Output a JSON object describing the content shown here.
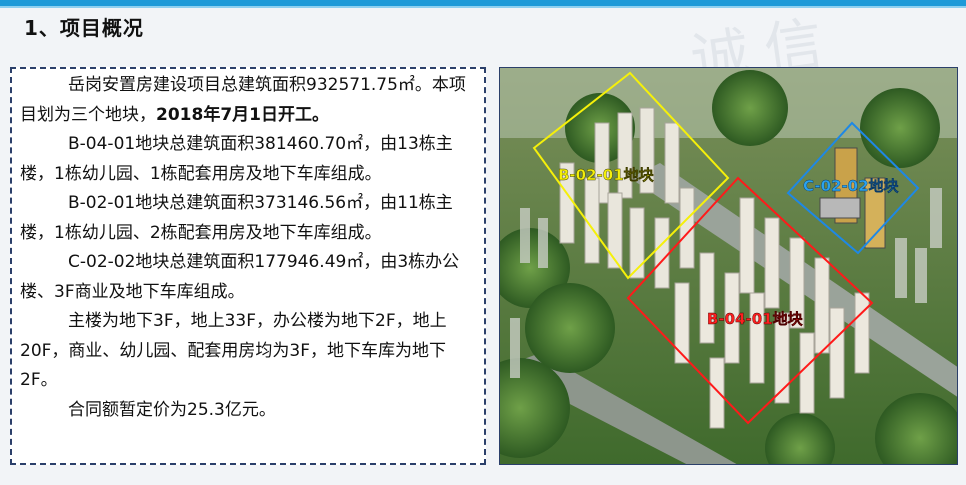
{
  "section_title": "1、项目概况",
  "watermark": "诚信",
  "paragraphs": [
    {
      "id": "p1",
      "text": "岳岗安置房建设项目总建筑面积932571.75㎡。本项目划为三个地块，",
      "bold": "2018年7月1日开工。"
    },
    {
      "id": "p2",
      "text": "B-04-01地块总建筑面积381460.70㎡，由13栋主楼，1栋幼儿园、1栋配套用房及地下车库组成。"
    },
    {
      "id": "p3",
      "text": "B-02-01地块总建筑面积373146.56㎡，由11栋主楼，1栋幼儿园、2栋配套用房及地下车库组成。"
    },
    {
      "id": "p4",
      "text": "C-02-02地块总建筑面积177946.49㎡，由3栋办公楼、3F商业及地下车库组成。"
    },
    {
      "id": "p5",
      "text": "主楼为地下3F，地上33F，办公楼为地下2F，地上20F，商业、幼儿园、配套用房均为3F，地下车库为地下2F。"
    },
    {
      "id": "p6",
      "text": "合同额暂定价为25.3亿元。"
    }
  ],
  "plots": [
    {
      "label": "B-02-01地块",
      "color": "#f5f00a"
    },
    {
      "label": "C-02-02地块",
      "color": "#1e88e5"
    },
    {
      "label": "B-04-01地块",
      "color": "#ff1a1a"
    }
  ]
}
